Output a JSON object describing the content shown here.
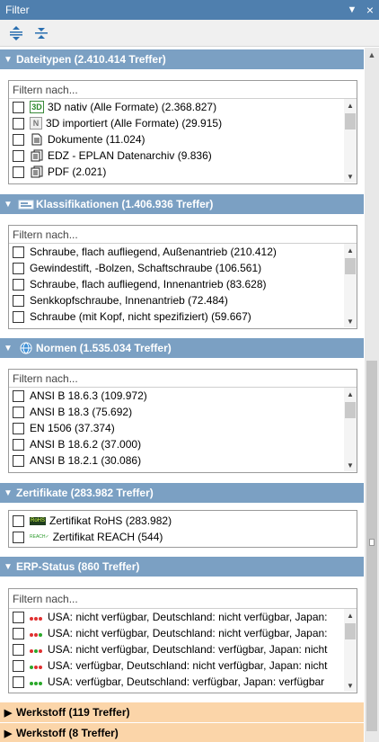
{
  "window": {
    "title": "Filter"
  },
  "filter_placeholder": "Filtern nach...",
  "dateitypen": {
    "title": "Dateitypen (2.410.414 Treffer)",
    "items": [
      {
        "icon": "3d-native-icon",
        "label": "3D nativ (Alle Formate) (2.368.827)"
      },
      {
        "icon": "3d-imported-icon",
        "label": "3D importiert (Alle Formate) (29.915)"
      },
      {
        "icon": "document-icon",
        "label": "Dokumente (11.024)"
      },
      {
        "icon": "edz-archive-icon",
        "label": "EDZ - EPLAN Datenarchiv (9.836)"
      },
      {
        "icon": "pdf-icon",
        "label": "PDF (2.021)"
      }
    ]
  },
  "klassifikationen": {
    "title": "Klassifikationen (1.406.936 Treffer)",
    "items": [
      "Schraube, flach aufliegend, Außenantrieb (210.412)",
      "Gewindestift, -Bolzen, Schaftschraube (106.561)",
      "Schraube, flach aufliegend, Innenantrieb (83.628)",
      "Senkkopfschraube, Innenantrieb (72.484)",
      "Schraube (mit Kopf, nicht spezifiziert) (59.667)"
    ]
  },
  "normen": {
    "title": "Normen (1.535.034 Treffer)",
    "items": [
      "ANSI B 18.6.3 (109.972)",
      "ANSI B 18.3 (75.692)",
      "EN 1506 (37.374)",
      "ANSI B 18.6.2 (37.000)",
      "ANSI B 18.2.1 (30.086)"
    ]
  },
  "zertifikate": {
    "title": "Zertifikate (283.982 Treffer)",
    "items": [
      {
        "icon": "rohs-icon",
        "badge": "RoHS",
        "label": "Zertifikat RoHS (283.982)"
      },
      {
        "icon": "reach-icon",
        "badge": "REACH✓",
        "label": "Zertifikat REACH (544)"
      }
    ]
  },
  "erp": {
    "title": "ERP-Status (860 Treffer)",
    "items": [
      {
        "dots": [
          "#e03030",
          "#e03030",
          "#e03030"
        ],
        "label": "USA: nicht verfügbar, Deutschland: nicht verfügbar, Japan:"
      },
      {
        "dots": [
          "#e03030",
          "#e03030",
          "#2aa82a"
        ],
        "label": "USA: nicht verfügbar, Deutschland: nicht verfügbar, Japan:"
      },
      {
        "dots": [
          "#e03030",
          "#2aa82a",
          "#e03030"
        ],
        "label": "USA: nicht verfügbar, Deutschland: verfügbar, Japan: nicht"
      },
      {
        "dots": [
          "#2aa82a",
          "#e03030",
          "#e03030"
        ],
        "label": "USA: verfügbar, Deutschland: nicht verfügbar, Japan: nicht"
      },
      {
        "dots": [
          "#2aa82a",
          "#2aa82a",
          "#2aa82a"
        ],
        "label": "USA: verfügbar, Deutschland: verfügbar, Japan: verfügbar"
      }
    ]
  },
  "werkstoff1": {
    "title": "Werkstoff (119 Treffer)"
  },
  "werkstoff2": {
    "title": "Werkstoff (8 Treffer)"
  },
  "colors": {
    "titlebar": "#4f7fae",
    "section_header": "#7ba0c3",
    "collapsed_header": "#fbd5a9"
  }
}
